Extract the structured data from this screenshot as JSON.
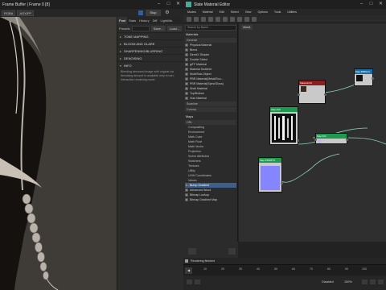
{
  "framebuffer": {
    "title": "Frame Buffer | Frame 0 [8]",
    "toolbar": {
      "mode_select": "RGBA",
      "display_select": "AGX/FP",
      "stop_label": "Stop"
    },
    "tabs": [
      "Post",
      "Stats",
      "History",
      "Diff",
      "LightMix"
    ],
    "active_tab": "Post",
    "presets_label": "Presets",
    "save_label": "Save...",
    "load_label": "Load...",
    "sections": [
      "TONE MAPPING",
      "BLOOM AND GLARE",
      "SHARPENING/BLURRING",
      "DENOISING",
      "INFO"
    ],
    "info_text": "Blending denoised image with original via denoising amount is available only in non-interactive rendering mode."
  },
  "sme": {
    "title": "Slate Material Editor",
    "menu": [
      "Modes",
      "Material",
      "Edit",
      "Select",
      "View",
      "Options",
      "Tools",
      "Utilities"
    ],
    "search_placeholder": "Search by Name ...",
    "view_tab": "View1",
    "tree": {
      "materials_header": "Materials",
      "general_header": "General",
      "general_items": [
        "Physical Material",
        "Blend",
        "DirectX Shader",
        "Double Sided",
        "glTF Material",
        "Material Switcher",
        "Multi/Sub-Object",
        "PBR Material(Metal/Rou...",
        "PBR Material(Spec/Gloss)",
        "Shell Material",
        "Top/Bottom",
        "Vlad Material"
      ],
      "scanline_label": "Scanline",
      "corona_label": "Corona",
      "maps_header": "Maps",
      "osl_label": "OSL",
      "osl_subs": [
        "Compositing",
        "Environment",
        "Math Color",
        "Math Float",
        "Math Vector",
        "Projection",
        "Scene Attributes",
        "Switchers",
        "Textures",
        "Utility",
        "UVW Coordinates",
        "Values"
      ],
      "bottom_items": [
        "Bump Gradient",
        "Advanced Wood",
        "Bitmap Lookup",
        "Bitmap Gradient Map"
      ]
    },
    "nodes": [
      {
        "title": "Map #8RN14",
        "sub": "Bitmap"
      },
      {
        "title": "Material #4",
        "sub": "Physical"
      },
      {
        "title": "Map #16",
        "sub": "Bitmap"
      },
      {
        "title": "Map #22",
        "sub": "Composite"
      },
      {
        "title": "Map #5908TN",
        "sub": "Normal"
      }
    ],
    "status_text": "Rendering finished",
    "timeline_ticks": [
      "10",
      "20",
      "30",
      "40",
      "50",
      "60",
      "70",
      "80",
      "90",
      "100"
    ],
    "bottom_labels": [
      "Disabled",
      "100%"
    ]
  }
}
